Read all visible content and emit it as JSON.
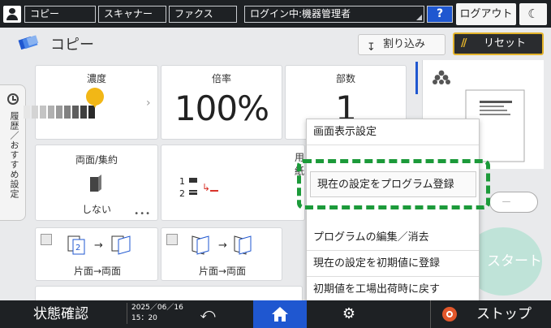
{
  "topbar": {
    "tabs": [
      "コピー",
      "スキャナー",
      "ファクス"
    ],
    "login": "ログイン中:機器管理者",
    "help": "?",
    "logout": "ログアウト",
    "moon": "☾"
  },
  "header": {
    "title": "コピー",
    "interrupt": "割り込み",
    "reset": "リセット"
  },
  "history_tab": "履歴／おすすめ設定",
  "panels": {
    "density": {
      "label": "濃度"
    },
    "ratio": {
      "label": "倍率",
      "value": "100%"
    },
    "copies": {
      "label": "部数",
      "value": "1"
    },
    "duplex": {
      "label": "両面/集約",
      "value": "しない"
    },
    "paper": {
      "label": "用紙"
    }
  },
  "duplex_options": [
    {
      "label": "片面→両面"
    },
    {
      "label": "片面→両面"
    }
  ],
  "menu": {
    "items": [
      "画面表示設定",
      "現在の設定をプログラム登録",
      "プログラムの編集／消去",
      "現在の設定を初期値に登録",
      "初期値を工場出荷時に戻す"
    ]
  },
  "start_label": "スタート",
  "bottom": {
    "status": "状態確認",
    "date": "2025／06／16",
    "time": "15：20",
    "stop": "ストップ"
  },
  "colors": {
    "accent_blue": "#1f57d0",
    "reset_border": "#e3b32b",
    "highlight_green": "#1c9a3a",
    "stop_red": "#e2572b"
  }
}
